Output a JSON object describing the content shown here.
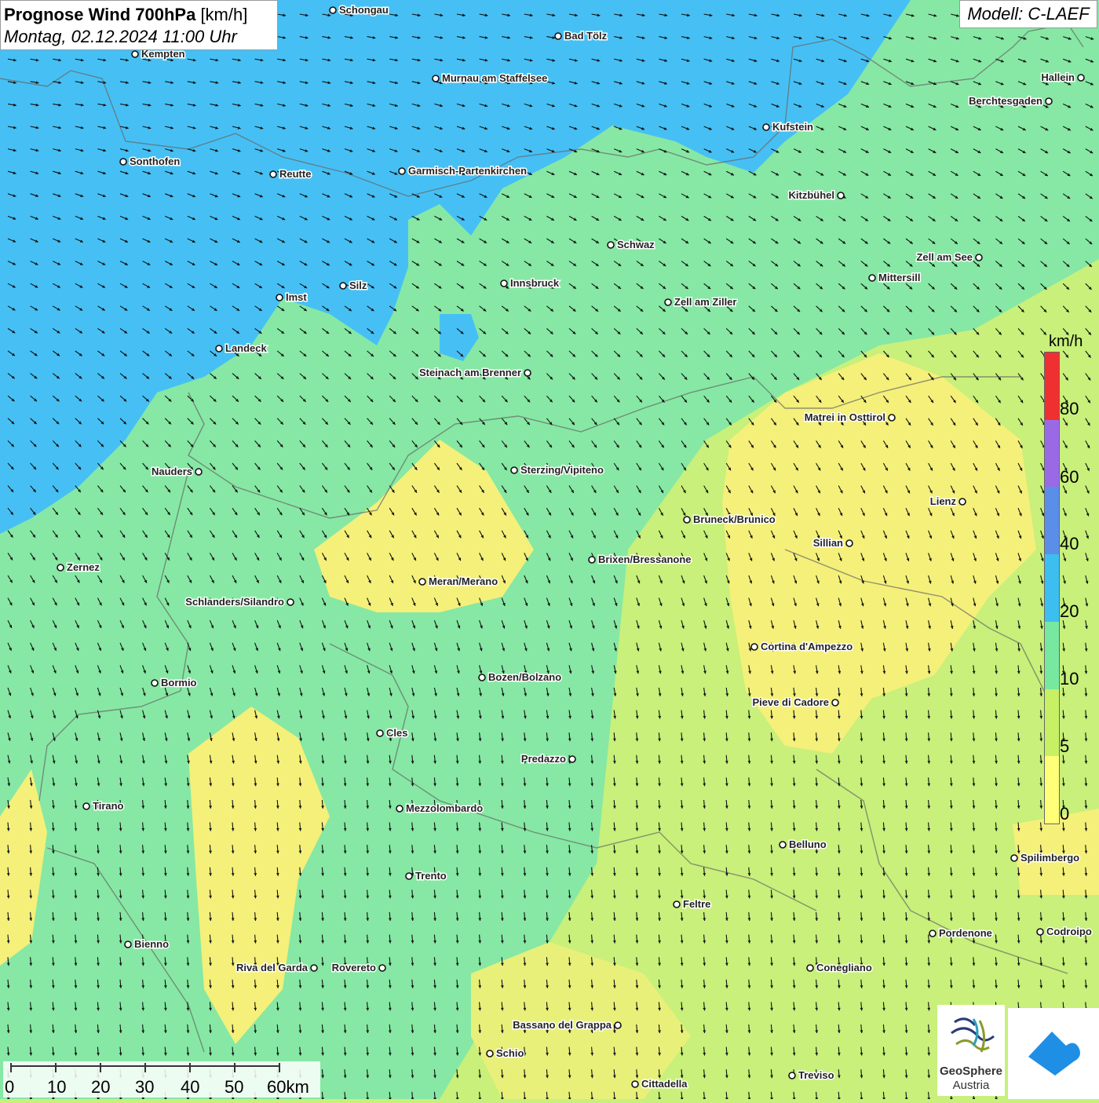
{
  "header": {
    "title": "Prognose Wind 700hPa",
    "title_unit": "[km/h]",
    "subtitle": "Montag, 02.12.2024 11:00 Uhr",
    "model": "Modell: C-LAEF"
  },
  "legend": {
    "unit": "km/h",
    "labels": [
      "80",
      "60",
      "40",
      "20",
      "10",
      "5",
      "0"
    ],
    "colors": [
      "#f03030",
      "#9a6ae6",
      "#5a8ee8",
      "#3cbef0",
      "#78e8a0",
      "#c8f064",
      "#ffff78"
    ]
  },
  "scale_bar": {
    "labels": [
      "0",
      "10",
      "20",
      "30",
      "40",
      "50",
      "60km"
    ]
  },
  "branding": {
    "name_line1": "GeoSphere",
    "name_line2": "Austria"
  },
  "cities": [
    {
      "name": "Schongau"
    },
    {
      "name": "Bad Tölz"
    },
    {
      "name": "Kempten"
    },
    {
      "name": "Murnau am Staffelsee"
    },
    {
      "name": "Hallein"
    },
    {
      "name": "Berchtesgaden"
    },
    {
      "name": "Kufstein"
    },
    {
      "name": "Sonthofen"
    },
    {
      "name": "Reutte"
    },
    {
      "name": "Garmisch-Partenkirchen"
    },
    {
      "name": "Kitzbühel"
    },
    {
      "name": "Schwaz"
    },
    {
      "name": "Zell am See"
    },
    {
      "name": "Mittersill"
    },
    {
      "name": "Innsbruck"
    },
    {
      "name": "Silz"
    },
    {
      "name": "Imst"
    },
    {
      "name": "Zell am Ziller"
    },
    {
      "name": "Landeck"
    },
    {
      "name": "Steinach am Brenner"
    },
    {
      "name": "Matrei in Osttirol"
    },
    {
      "name": "Nauders"
    },
    {
      "name": "Sterzing/Vipiteno"
    },
    {
      "name": "Lienz"
    },
    {
      "name": "Bruneck/Brunico"
    },
    {
      "name": "Sillian"
    },
    {
      "name": "Zernez"
    },
    {
      "name": "Brixen/Bressanone"
    },
    {
      "name": "Meran/Merano"
    },
    {
      "name": "Schlanders/Silandro"
    },
    {
      "name": "Cortina d'Ampezzo"
    },
    {
      "name": "Bozen/Bolzano"
    },
    {
      "name": "Bormio"
    },
    {
      "name": "Pieve di Cadore"
    },
    {
      "name": "Cles"
    },
    {
      "name": "Predazzo"
    },
    {
      "name": "Tirano"
    },
    {
      "name": "Mezzolombardo"
    },
    {
      "name": "Belluno"
    },
    {
      "name": "Spilimbergo"
    },
    {
      "name": "Trento"
    },
    {
      "name": "Feltre"
    },
    {
      "name": "Pordenone"
    },
    {
      "name": "Codroipo"
    },
    {
      "name": "Bienno"
    },
    {
      "name": "Riva del Garda"
    },
    {
      "name": "Rovereto"
    },
    {
      "name": "Conegliano"
    },
    {
      "name": "Bassano del Grappa"
    },
    {
      "name": "Schio"
    },
    {
      "name": "Treviso"
    },
    {
      "name": "Cittadella"
    }
  ]
}
